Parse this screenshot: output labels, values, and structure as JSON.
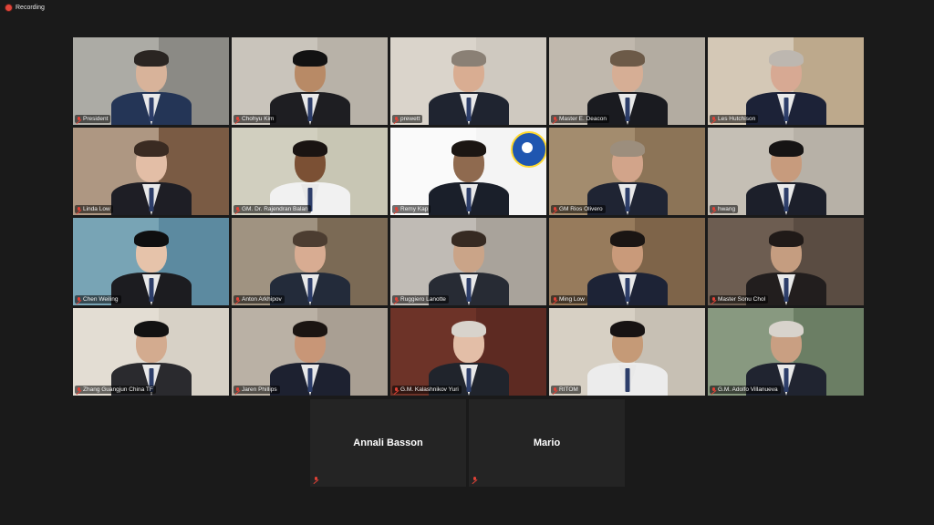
{
  "recording": {
    "label": "Recording"
  },
  "participants": [
    {
      "name": "President",
      "bg": "#8b8a85",
      "wall": "#c9c6bf",
      "suit": "#243556",
      "skin": "#d8b39a",
      "hair": "#2a2522"
    },
    {
      "name": "Chohyu Kim",
      "bg": "#b8b2a8",
      "wall": "#d7d3cb",
      "suit": "#1e1e22",
      "skin": "#b88a66",
      "hair": "#121212"
    },
    {
      "name": "prewett",
      "bg": "#cfc9c0",
      "wall": "#e3ddd3",
      "suit": "#1f2430",
      "skin": "#d9ad92",
      "hair": "#8a8075"
    },
    {
      "name": "Master E. Deacon",
      "bg": "#b3aca1",
      "wall": "#cbc3b8",
      "suit": "#1a1b20",
      "skin": "#d6ae95",
      "hair": "#6c5a48"
    },
    {
      "name": "Les Hutchison",
      "bg": "#bda98c",
      "wall": "#e8e2d8",
      "suit": "#1c2237",
      "skin": "#d7a993",
      "hair": "#bdb7b0"
    },
    {
      "name": "Linda Low",
      "bg": "#7a5b44",
      "wall": "#d8c8b6",
      "suit": "#1e1e25",
      "skin": "#e3bea6",
      "hair": "#3a2b22"
    },
    {
      "name": "GM. Dr. Rajendran Balan",
      "bg": "#c8c6b4",
      "wall": "#d9d7c9",
      "suit": "#f1f1f1",
      "skin": "#7b5034",
      "hair": "#1a1412"
    },
    {
      "name": "Remy Kap",
      "bg": "#f4f4f4",
      "wall": "#ffffff",
      "suit": "#1a1f2a",
      "skin": "#8f6a4f",
      "hair": "#1b1613",
      "active": true
    },
    {
      "name": "GM Rios Olivero",
      "bg": "#8c7457",
      "wall": "#b6a081",
      "suit": "#1f2433",
      "skin": "#d2a48a",
      "hair": "#9c8e7d"
    },
    {
      "name": "hwang",
      "bg": "#b7b1a7",
      "wall": "#d1cbc1",
      "suit": "#1c1f2a",
      "skin": "#c79b7d",
      "hair": "#161414"
    },
    {
      "name": "Chen Weiling",
      "bg": "#5c8aa0",
      "wall": "#8fb9c6",
      "suit": "#1c1c20",
      "skin": "#e6c3aa",
      "hair": "#0f0f10"
    },
    {
      "name": "Anton Arkhipov",
      "bg": "#7b6a55",
      "wall": "#bfb4a6",
      "suit": "#232b3a",
      "skin": "#d8ac92",
      "hair": "#4c3d31"
    },
    {
      "name": "Ruggiero Lanotte",
      "bg": "#a9a39b",
      "wall": "#d4d0ca",
      "suit": "#272b34",
      "skin": "#caa488",
      "hair": "#362a22"
    },
    {
      "name": "Ming Low",
      "bg": "#7e6449",
      "wall": "#ab8e6c",
      "suit": "#1d2336",
      "skin": "#c99a7a",
      "hair": "#1a1513"
    },
    {
      "name": "Master Sonu Chol",
      "bg": "#5a4c42",
      "wall": "#7d6c5f",
      "suit": "#221e1e",
      "skin": "#c59d80",
      "hair": "#201a18"
    },
    {
      "name": "Zhang Guangjun China TF",
      "bg": "#d7d1c6",
      "wall": "#ece7de",
      "suit": "#2a2a2e",
      "skin": "#d3ab8f",
      "hair": "#121212"
    },
    {
      "name": "Jaren Phillips",
      "bg": "#a99f93",
      "wall": "#c8c0b4",
      "suit": "#1d2130",
      "skin": "#c89677",
      "hair": "#1b1512"
    },
    {
      "name": "G.M. Kalashnikov Yuri",
      "bg": "#5d2a22",
      "wall": "#7a3a2e",
      "suit": "#20242c",
      "skin": "#e3bea7",
      "hair": "#d8d3cc"
    },
    {
      "name": "RITOM",
      "bg": "#c7c0b4",
      "wall": "#e4ddd1",
      "suit": "#ececec",
      "skin": "#c59a77",
      "hair": "#171313"
    },
    {
      "name": "G.M. Adolfo Villanueva",
      "bg": "#6b7e64",
      "wall": "#a0ae97",
      "suit": "#202430",
      "skin": "#c99f82",
      "hair": "#d8d3cc"
    }
  ],
  "audio_only": [
    {
      "name": "Annali Basson"
    },
    {
      "name": "Mario"
    }
  ]
}
